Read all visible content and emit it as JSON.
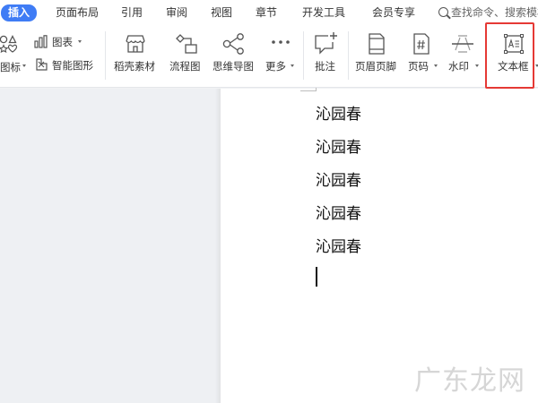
{
  "menu": {
    "tabs": [
      {
        "label": "插入",
        "active": true
      },
      {
        "label": "页面布局"
      },
      {
        "label": "引用"
      },
      {
        "label": "审阅"
      },
      {
        "label": "视图"
      },
      {
        "label": "章节"
      },
      {
        "label": "开发工具"
      },
      {
        "label": "会员专享"
      }
    ],
    "search_text": "查找命令、搜索模板"
  },
  "ribbon": {
    "icons_label": "图标",
    "chart_label": "图表",
    "smart_art_label": "智能图形",
    "materials_label": "稻壳素材",
    "flowchart_label": "流程图",
    "mindmap_label": "思维导图",
    "more_label": "更多",
    "comment_label": "批注",
    "header_footer_label": "页眉页脚",
    "page_number_label": "页码",
    "watermark_label": "水印",
    "textbox_label": "文本框"
  },
  "document": {
    "paragraphs": [
      "沁园春",
      "沁园春",
      "沁园春",
      "沁园春",
      "沁园春"
    ]
  },
  "watermark_text": "广东龙网",
  "colors": {
    "accent": "#3f7cf5",
    "highlight_box": "#e53935",
    "document_background": "#eef0f3"
  }
}
